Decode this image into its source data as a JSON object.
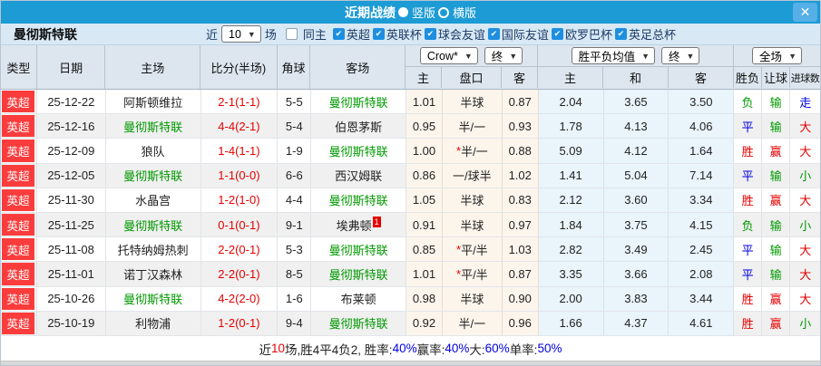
{
  "palette": {
    "red": "#e60000",
    "green": "#009900",
    "blue": "#0000e0",
    "black": "#222222",
    "accent": "#1d9bd4",
    "badge_red": "#fb3c3c",
    "team_green": "#009900"
  },
  "titlebar": {
    "title": "近期战绩",
    "options": [
      {
        "label": "竖版",
        "selected": true
      },
      {
        "label": "横版",
        "selected": false
      }
    ],
    "close_icon": "✕"
  },
  "filterbar": {
    "team": "曼彻斯特联",
    "near_label": "近",
    "count_value": "10",
    "matches_label": "场",
    "same_home_label": "同主",
    "same_home_checked": false,
    "leagues": [
      {
        "label": "英超",
        "checked": true
      },
      {
        "label": "英联杯",
        "checked": true
      },
      {
        "label": "球会友谊",
        "checked": true
      },
      {
        "label": "国际友谊",
        "checked": true
      },
      {
        "label": "欧罗巴杯",
        "checked": true
      },
      {
        "label": "英足总杯",
        "checked": true
      }
    ]
  },
  "header": {
    "col_type": "类型",
    "col_date": "日期",
    "col_home": "主场",
    "col_score": "比分(半场)",
    "col_corner": "角球",
    "col_away": "客场",
    "asia_source": "Crow*",
    "asia_period": "终",
    "europe_source": "胜平负均值",
    "europe_period": "终",
    "scope": "全场",
    "sub_asia": [
      "主",
      "盘口",
      "客"
    ],
    "sub_europe": [
      "主",
      "和",
      "客"
    ],
    "sub_result": [
      "胜负",
      "让球",
      "进球数"
    ]
  },
  "result_color_map": {
    "胜": "red",
    "平": "blue",
    "负": "green",
    "赢": "red",
    "输": "green",
    "走": "blue",
    "大": "red",
    "小": "green"
  },
  "rows": [
    {
      "league": "英超",
      "date": "25-12-22",
      "home": "阿斯顿维拉",
      "score": "2-1(1-1)",
      "corner": "5-5",
      "away": "曼彻斯特联",
      "asia_home": "1.01",
      "handicap": "半球",
      "asia_away": "0.87",
      "odds_win": "2.04",
      "odds_draw": "3.65",
      "odds_lose": "3.50",
      "result": "负",
      "handicap_result": "输",
      "goals_result": "走"
    },
    {
      "league": "英超",
      "date": "25-12-16",
      "home": "曼彻斯特联",
      "score": "4-4(2-1)",
      "corner": "5-4",
      "away": "伯恩茅斯",
      "asia_home": "0.95",
      "handicap": "半/一",
      "asia_away": "0.93",
      "odds_win": "1.78",
      "odds_draw": "4.13",
      "odds_lose": "4.06",
      "result": "平",
      "handicap_result": "输",
      "goals_result": "大"
    },
    {
      "league": "英超",
      "date": "25-12-09",
      "home": "狼队",
      "score": "1-4(1-1)",
      "corner": "1-9",
      "away": "曼彻斯特联",
      "asia_home": "1.00",
      "handicap": "*半/一",
      "asia_away": "0.88",
      "odds_win": "5.09",
      "odds_draw": "4.12",
      "odds_lose": "1.64",
      "result": "胜",
      "handicap_result": "赢",
      "goals_result": "大"
    },
    {
      "league": "英超",
      "date": "25-12-05",
      "home": "曼彻斯特联",
      "score": "1-1(0-0)",
      "corner": "6-6",
      "away": "西汉姆联",
      "asia_home": "0.86",
      "handicap": "一/球半",
      "asia_away": "1.02",
      "odds_win": "1.41",
      "odds_draw": "5.04",
      "odds_lose": "7.14",
      "result": "平",
      "handicap_result": "输",
      "goals_result": "小"
    },
    {
      "league": "英超",
      "date": "25-11-30",
      "home": "水晶宫",
      "score": "1-2(1-0)",
      "corner": "4-4",
      "away": "曼彻斯特联",
      "asia_home": "1.05",
      "handicap": "半球",
      "asia_away": "0.83",
      "odds_win": "2.12",
      "odds_draw": "3.60",
      "odds_lose": "3.34",
      "result": "胜",
      "handicap_result": "赢",
      "goals_result": "大"
    },
    {
      "league": "英超",
      "date": "25-11-25",
      "home": "曼彻斯特联",
      "score": "0-1(0-1)",
      "corner": "9-1",
      "away": "埃弗顿",
      "away_card": "1",
      "asia_home": "0.91",
      "handicap": "半球",
      "asia_away": "0.97",
      "odds_win": "1.84",
      "odds_draw": "3.75",
      "odds_lose": "4.15",
      "result": "负",
      "handicap_result": "输",
      "goals_result": "小"
    },
    {
      "league": "英超",
      "date": "25-11-08",
      "home": "托特纳姆热刺",
      "score": "2-2(0-1)",
      "corner": "5-3",
      "away": "曼彻斯特联",
      "asia_home": "0.85",
      "handicap": "*平/半",
      "asia_away": "1.03",
      "odds_win": "2.82",
      "odds_draw": "3.49",
      "odds_lose": "2.45",
      "result": "平",
      "handicap_result": "输",
      "goals_result": "大"
    },
    {
      "league": "英超",
      "date": "25-11-01",
      "home": "诺丁汉森林",
      "score": "2-2(0-1)",
      "corner": "8-5",
      "away": "曼彻斯特联",
      "asia_home": "1.01",
      "handicap": "*平/半",
      "asia_away": "0.87",
      "odds_win": "3.35",
      "odds_draw": "3.66",
      "odds_lose": "2.08",
      "result": "平",
      "handicap_result": "输",
      "goals_result": "大"
    },
    {
      "league": "英超",
      "date": "25-10-26",
      "home": "曼彻斯特联",
      "score": "4-2(2-0)",
      "corner": "1-6",
      "away": "布莱顿",
      "asia_home": "0.98",
      "handicap": "半球",
      "asia_away": "0.90",
      "odds_win": "2.00",
      "odds_draw": "3.83",
      "odds_lose": "3.44",
      "result": "胜",
      "handicap_result": "赢",
      "goals_result": "大"
    },
    {
      "league": "英超",
      "date": "25-10-19",
      "home": "利物浦",
      "score": "1-2(0-1)",
      "corner": "9-4",
      "away": "曼彻斯特联",
      "asia_home": "0.92",
      "handicap": "半/一",
      "asia_away": "0.96",
      "odds_win": "1.66",
      "odds_draw": "4.37",
      "odds_lose": "4.61",
      "result": "胜",
      "handicap_result": "赢",
      "goals_result": "小"
    }
  ],
  "footer": {
    "segments": [
      {
        "text": "近",
        "color": "black"
      },
      {
        "text": "10",
        "color": "red"
      },
      {
        "text": "场,胜4平4负2, 胜率:",
        "color": "black"
      },
      {
        "text": "40%",
        "color": "blue"
      },
      {
        "text": " 赢率:",
        "color": "black"
      },
      {
        "text": "40%",
        "color": "blue"
      },
      {
        "text": " 大:",
        "color": "black"
      },
      {
        "text": "60%",
        "color": "blue"
      },
      {
        "text": " 单率:",
        "color": "black"
      },
      {
        "text": "50%",
        "color": "blue"
      }
    ]
  }
}
